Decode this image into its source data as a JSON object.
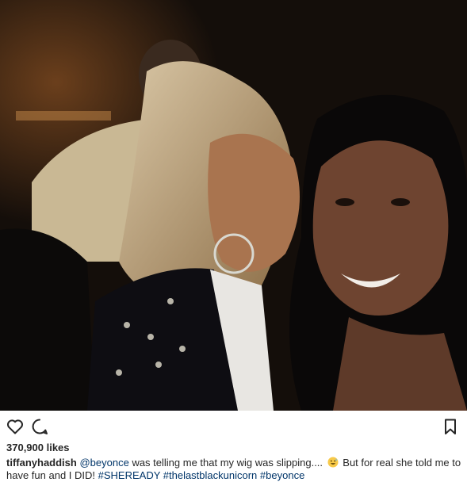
{
  "post": {
    "image_alt": "Two women posing for a selfie at a dark party",
    "likes": "370,900 likes",
    "caption": {
      "username": "tiffanyhaddish",
      "mention": "@beyonce",
      "text_1": " was telling me that my wig was slipping.... ",
      "emoji": "grinning-face-with-sweat-emoji",
      "text_2": " But for real she told me to have fun and I DID! ",
      "hashtags": [
        "#SHEREADY",
        "#thelastblackunicorn",
        "#beyonce"
      ]
    }
  },
  "actions": {
    "like_icon": "heart-outline-icon",
    "comment_icon": "comment-bubble-icon",
    "save_icon": "bookmark-outline-icon"
  },
  "colors": {
    "text": "#262626",
    "link": "#003569",
    "background": "#ffffff"
  }
}
